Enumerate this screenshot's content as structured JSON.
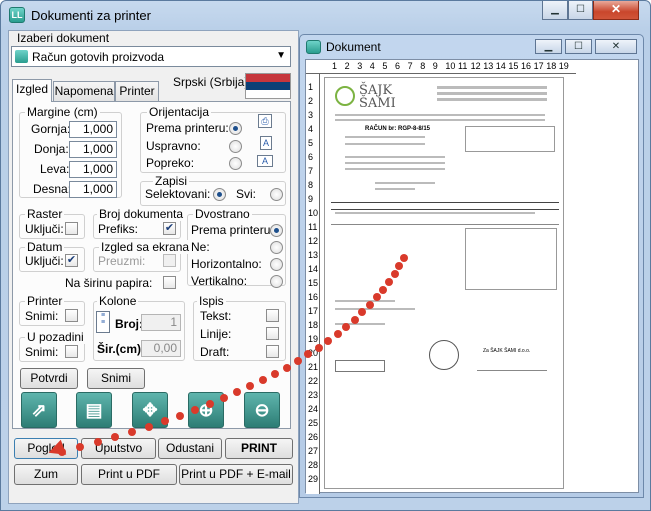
{
  "main": {
    "title": "Dokumenti za printer",
    "doc_select_label": "Izaberi dokument",
    "doc_select_value": "Račun gotovih proizvoda",
    "language": "Srpski (Srbija)",
    "tabs": [
      {
        "label": "Izgled"
      },
      {
        "label": "Napomena"
      },
      {
        "label": "Printer"
      }
    ],
    "margins": {
      "title": "Margine (cm)",
      "rows": [
        {
          "label": "Gornja:",
          "value": "1,000"
        },
        {
          "label": "Donja:",
          "value": "1,000"
        },
        {
          "label": "Leva:",
          "value": "1,000"
        },
        {
          "label": "Desna:",
          "value": "1,000"
        }
      ]
    },
    "orientation": {
      "title": "Orijentacija",
      "options": [
        {
          "label": "Prema printeru:",
          "selected": true
        },
        {
          "label": "Uspravno:",
          "selected": false
        },
        {
          "label": "Popreko:",
          "selected": false
        }
      ]
    },
    "records": {
      "title": "Zapisi",
      "selected_label": "Selektovani:",
      "all_label": "Svi:"
    },
    "raster": {
      "title": "Raster",
      "enable_label": "Uključi:"
    },
    "doc_number": {
      "title": "Broj dokumenta",
      "prefix_label": "Prefiks:"
    },
    "duplex": {
      "title": "Dvostrano",
      "options": [
        {
          "label": "Prema printeru:",
          "selected": true
        },
        {
          "label": "Ne:",
          "selected": false
        },
        {
          "label": "Horizontalno:",
          "selected": false
        },
        {
          "label": "Vertikalno:",
          "selected": false
        }
      ]
    },
    "date": {
      "title": "Datum",
      "enable_label": "Uključi:"
    },
    "screen_layout": {
      "title": "Izgled sa ekrana",
      "take_label": "Preuzmi:"
    },
    "paper_width_label": "Na širinu papira:",
    "printer_group": {
      "title": "Printer",
      "save_label": "Snimi:"
    },
    "columns": {
      "title": "Kolone",
      "count_label": "Broj:",
      "count_value": "1",
      "width_label": "Šir.(cm):",
      "width_value": "0,00"
    },
    "print_group": {
      "title": "Ispis",
      "text_label": "Tekst:",
      "lines_label": "Linije:",
      "draft_label": "Draft:"
    },
    "background": {
      "title": "U pozadini",
      "save_label": "Snimi:"
    },
    "buttons": {
      "confirm": "Potvrdi",
      "save": "Snimi",
      "preview": "Pogled",
      "manual": "Uputstvo",
      "cancel": "Odustani",
      "print": "PRINT",
      "zoom": "Zum",
      "print_pdf": "Print u PDF",
      "print_pdf_email": "Print u PDF + E-mail"
    }
  },
  "document_window": {
    "title": "Dokument",
    "ruler_numbers": [
      "1",
      "2",
      "3",
      "4",
      "5",
      "6",
      "7",
      "8",
      "9",
      "10",
      "11",
      "12",
      "13",
      "14",
      "15",
      "16",
      "17",
      "18",
      "19",
      "20",
      "21",
      "22",
      "23",
      "24",
      "25",
      "26",
      "27",
      "28",
      "29"
    ],
    "page": {
      "logo_text": "ŠAJK ŠAMI",
      "heading": "RAČUN br: RGP-8-8/15",
      "signature_caption": "Za ŠAJK ŠAMI d.o.o."
    }
  }
}
